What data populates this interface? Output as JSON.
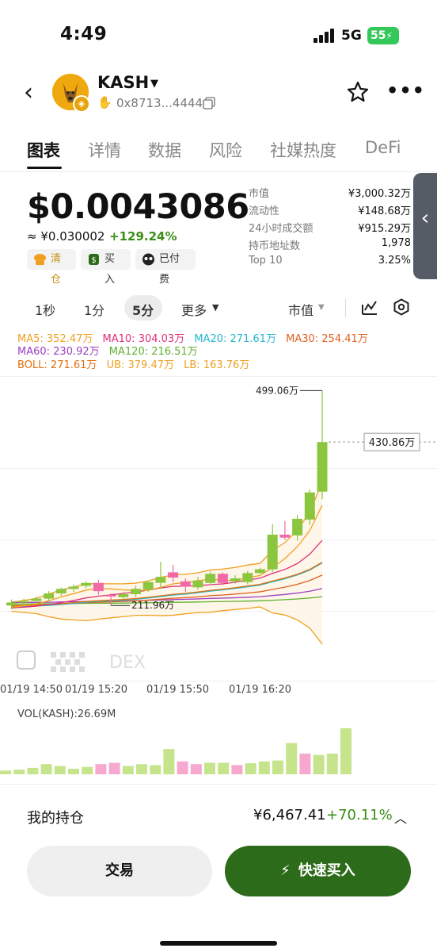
{
  "status": {
    "time": "4:49",
    "network": "5G",
    "battery": "55"
  },
  "header": {
    "token_name": "KASH",
    "address": "0x8713...4444"
  },
  "tabs": [
    "图表",
    "详情",
    "数据",
    "风险",
    "社媒热度",
    "DeFi"
  ],
  "price": {
    "usd": "$0.0043086",
    "cny": "≈ ¥0.030002",
    "change": "+129.24%",
    "actions": [
      "清仓",
      "买入",
      "已付费"
    ]
  },
  "stats": [
    {
      "label": "市值",
      "value": "¥3,000.32万"
    },
    {
      "label": "流动性",
      "value": "¥148.68万"
    },
    {
      "label": "24小时成交额",
      "value": "¥915.29万"
    },
    {
      "label": "持币地址数",
      "value": "1,978"
    },
    {
      "label": "Top 10",
      "value": "3.25%"
    }
  ],
  "intervals": {
    "items": [
      "1秒",
      "1分",
      "5分"
    ],
    "active": "5分",
    "more": "更多",
    "metric": "市值"
  },
  "indicators": {
    "row1": [
      "MA5: 352.47万",
      "MA10: 304.03万",
      "MA20: 271.61万",
      "MA30: 254.41万"
    ],
    "row2": [
      "MA60: 230.92万",
      "MA120: 216.51万"
    ],
    "row3": [
      "BOLL: 271.61万",
      "UB: 379.47万",
      "LB: 163.76万"
    ],
    "colors": {
      "ma5": "#f0a020",
      "ma10": "#e0307a",
      "ma20": "#22b8d0",
      "ma30": "#e06020",
      "ma60": "#9b3fc0",
      "ma120": "#60b030",
      "boll": "#e07010",
      "ub": "#f0a020",
      "lb": "#f0a020"
    }
  },
  "chart_data": {
    "type": "candlestick",
    "series_name": "KASH 市值 (万)",
    "high_label": "499.06万",
    "low_label": "211.96万",
    "last_label": "430.86万",
    "x_ticks": [
      "01/19 14:50",
      "01/19 15:20",
      "01/19 15:50",
      "01/19 16:20"
    ],
    "candles": [
      {
        "o": 214,
        "c": 218,
        "h": 222,
        "l": 209,
        "up": true
      },
      {
        "o": 218,
        "c": 220,
        "h": 223,
        "l": 215,
        "up": true
      },
      {
        "o": 220,
        "c": 223,
        "h": 226,
        "l": 217,
        "up": true
      },
      {
        "o": 223,
        "c": 230,
        "h": 233,
        "l": 220,
        "up": true
      },
      {
        "o": 230,
        "c": 236,
        "h": 238,
        "l": 227,
        "up": true
      },
      {
        "o": 236,
        "c": 239,
        "h": 242,
        "l": 232,
        "up": true
      },
      {
        "o": 240,
        "c": 244,
        "h": 246,
        "l": 237,
        "up": true
      },
      {
        "o": 244,
        "c": 233,
        "h": 248,
        "l": 228,
        "up": false
      },
      {
        "o": 228,
        "c": 228,
        "h": 230,
        "l": 214,
        "up": false
      },
      {
        "o": 225,
        "c": 229,
        "h": 232,
        "l": 222,
        "up": true
      },
      {
        "o": 229,
        "c": 236,
        "h": 240,
        "l": 225,
        "up": true
      },
      {
        "o": 235,
        "c": 245,
        "h": 247,
        "l": 232,
        "up": true
      },
      {
        "o": 244,
        "c": 252,
        "h": 272,
        "l": 236,
        "up": true
      },
      {
        "o": 258,
        "c": 251,
        "h": 268,
        "l": 245,
        "up": false
      },
      {
        "o": 246,
        "c": 239,
        "h": 250,
        "l": 232,
        "up": false
      },
      {
        "o": 238,
        "c": 247,
        "h": 252,
        "l": 235,
        "up": true
      },
      {
        "o": 244,
        "c": 256,
        "h": 259,
        "l": 241,
        "up": true
      },
      {
        "o": 256,
        "c": 244,
        "h": 258,
        "l": 241,
        "up": false
      },
      {
        "o": 246,
        "c": 250,
        "h": 254,
        "l": 243,
        "up": true
      },
      {
        "o": 245,
        "c": 257,
        "h": 260,
        "l": 242,
        "up": true
      },
      {
        "o": 257,
        "c": 262,
        "h": 264,
        "l": 256,
        "up": true
      },
      {
        "o": 262,
        "c": 308,
        "h": 322,
        "l": 258,
        "up": true
      },
      {
        "o": 308,
        "c": 304,
        "h": 326,
        "l": 301,
        "up": false
      },
      {
        "o": 307,
        "c": 329,
        "h": 334,
        "l": 300,
        "up": true
      },
      {
        "o": 328,
        "c": 364,
        "h": 368,
        "l": 321,
        "up": true
      },
      {
        "o": 365,
        "c": 430.86,
        "h": 499.06,
        "l": 355,
        "up": true
      }
    ],
    "volume_label": "VOL(KASH):26.69M",
    "volume": [
      0.08,
      0.1,
      0.14,
      0.22,
      0.18,
      0.12,
      0.16,
      0.22,
      0.25,
      0.18,
      0.22,
      0.2,
      0.55,
      0.28,
      0.22,
      0.25,
      0.25,
      0.2,
      0.24,
      0.28,
      0.3,
      0.68,
      0.45,
      0.42,
      0.45,
      1.0
    ]
  },
  "watermark": "DEX",
  "holdings": {
    "label": "我的持仓",
    "value": "¥6,467.41",
    "change": "+70.11%"
  },
  "buttons": {
    "trade": "交易",
    "quick_buy": "快速买入"
  }
}
